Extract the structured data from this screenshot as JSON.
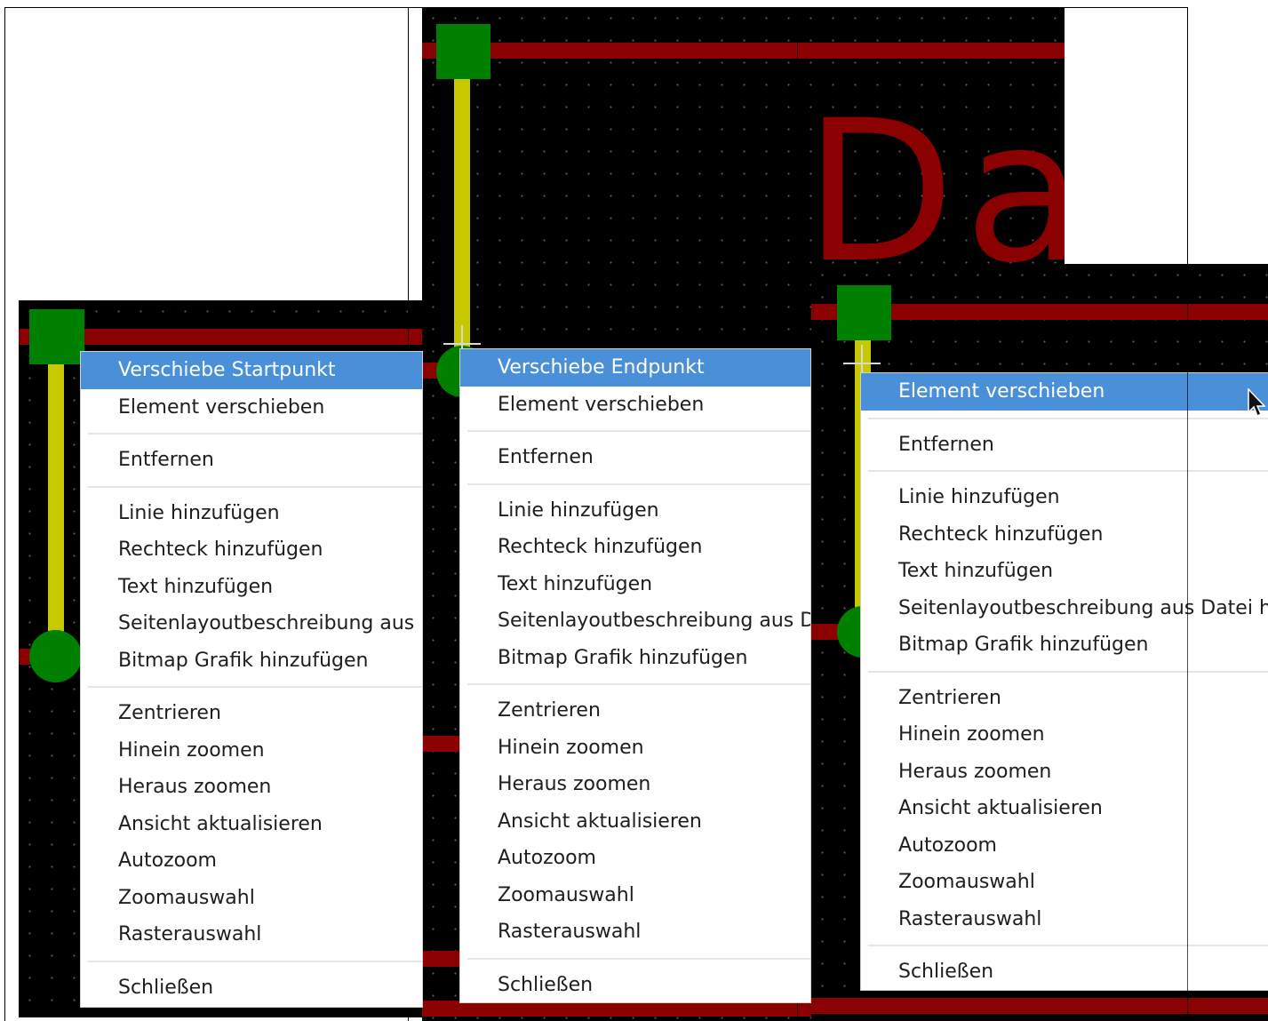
{
  "canvas_text": {
    "letter_d": "D",
    "letter_a": "a"
  },
  "menu_start": {
    "items": [
      {
        "label": "Verschiebe Startpunkt",
        "highlight": true
      },
      {
        "label": "Element verschieben"
      },
      {
        "sep": true
      },
      {
        "label": "Entfernen"
      },
      {
        "sep": true
      },
      {
        "label": "Linie hinzufügen"
      },
      {
        "label": "Rechteck hinzufügen"
      },
      {
        "label": "Text hinzufügen"
      },
      {
        "label": "Seitenlayoutbeschreibung aus Datei hinzufügen"
      },
      {
        "label": "Bitmap Grafik hinzufügen"
      },
      {
        "sep": true
      },
      {
        "label": "Zentrieren"
      },
      {
        "label": "Hinein zoomen"
      },
      {
        "label": "Heraus zoomen"
      },
      {
        "label": "Ansicht aktualisieren"
      },
      {
        "label": "Autozoom"
      },
      {
        "label": "Zoomauswahl"
      },
      {
        "label": "Rasterauswahl"
      },
      {
        "sep": true
      },
      {
        "label": "Schließen"
      }
    ]
  },
  "menu_end": {
    "items": [
      {
        "label": "Verschiebe Endpunkt",
        "highlight": true
      },
      {
        "label": "Element verschieben"
      },
      {
        "sep": true
      },
      {
        "label": "Entfernen"
      },
      {
        "sep": true
      },
      {
        "label": "Linie hinzufügen"
      },
      {
        "label": "Rechteck hinzufügen"
      },
      {
        "label": "Text hinzufügen"
      },
      {
        "label": "Seitenlayoutbeschreibung aus Datei hinzufügen"
      },
      {
        "label": "Bitmap Grafik hinzufügen"
      },
      {
        "sep": true
      },
      {
        "label": "Zentrieren"
      },
      {
        "label": "Hinein zoomen"
      },
      {
        "label": "Heraus zoomen"
      },
      {
        "label": "Ansicht aktualisieren"
      },
      {
        "label": "Autozoom"
      },
      {
        "label": "Zoomauswahl"
      },
      {
        "label": "Rasterauswahl"
      },
      {
        "sep": true
      },
      {
        "label": "Schließen"
      }
    ]
  },
  "menu_element": {
    "items": [
      {
        "label": "Element verschieben",
        "highlight": true
      },
      {
        "sep": true
      },
      {
        "label": "Entfernen"
      },
      {
        "sep": true
      },
      {
        "label": "Linie hinzufügen"
      },
      {
        "label": "Rechteck hinzufügen"
      },
      {
        "label": "Text hinzufügen"
      },
      {
        "label": "Seitenlayoutbeschreibung aus Datei hinzufügen"
      },
      {
        "label": "Bitmap Grafik hinzufügen"
      },
      {
        "sep": true
      },
      {
        "label": "Zentrieren"
      },
      {
        "label": "Hinein zoomen"
      },
      {
        "label": "Heraus zoomen"
      },
      {
        "label": "Ansicht aktualisieren"
      },
      {
        "label": "Autozoom"
      },
      {
        "label": "Zoomauswahl"
      },
      {
        "label": "Rasterauswahl"
      },
      {
        "sep": true
      },
      {
        "label": "Schließen"
      }
    ]
  },
  "icons": {
    "cursor": "crosshair-cursor-icon",
    "pointer": "mouse-pointer-icon"
  },
  "colors": {
    "canvas_bg": "#000000",
    "page_border": "#8b0000",
    "pad": "#008000",
    "trace": "#c8c800",
    "menu_highlight": "#4a90d9"
  }
}
